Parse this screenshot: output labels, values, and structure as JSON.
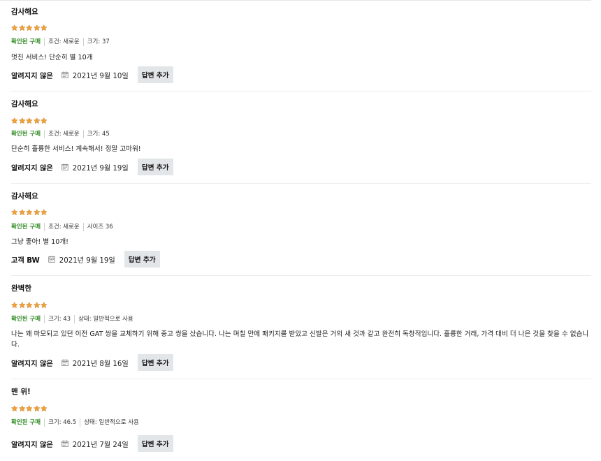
{
  "reviews": [
    {
      "title": "감사해요",
      "rating": 5,
      "verified_label": "확인된 구매",
      "attributes": [
        "조건: 새로운",
        "크기: 37"
      ],
      "body": "멋진 서비스! 단순히 별 10개",
      "author": "알려지지 않은",
      "date": "2021년 9월 10일",
      "reply_label": "답변 추가"
    },
    {
      "title": "감사해요",
      "rating": 5,
      "verified_label": "확인된 구매",
      "attributes": [
        "조건: 새로운",
        "크기: 45"
      ],
      "body": "단순히 훌륭한 서비스! 계속해서! 정말 고마워!",
      "author": "알려지지 않은",
      "date": "2021년 9월 19일",
      "reply_label": "답변 추가"
    },
    {
      "title": "감사해요",
      "rating": 5,
      "verified_label": "확인된 구매",
      "attributes": [
        "조건: 새로운",
        "사이즈 36"
      ],
      "body": "그냥 좋아! 별 10개!",
      "author": "고객 BW",
      "date": "2021년 9월 19일",
      "reply_label": "답변 추가"
    },
    {
      "title": "완벽한",
      "rating": 5,
      "verified_label": "확인된 구매",
      "attributes": [
        "크기: 43",
        "상태: 일반적으로 사용"
      ],
      "body": "나는 꽤 마모되고 있던 이전 GAT 쌍을 교체하기 위해 중고 쌍을 샀습니다. 나는 며칠 만에 패키지를 받았고 신발은 거의 새 것과 같고 완전히 독창적입니다. 훌륭한 거래, 가격 대비 더 나은 것을 찾을 수 없습니다.",
      "author": "알려지지 않은",
      "date": "2021년 8월 16일",
      "reply_label": "답변 추가"
    },
    {
      "title": "맨 위!",
      "rating": 5,
      "verified_label": "확인된 구매",
      "attributes": [
        "크기: 46.5",
        "상태: 일반적으로 사용"
      ],
      "body": "",
      "author": "알려지지 않은",
      "date": "2021년 7월 24일",
      "reply_label": "답변 추가"
    }
  ],
  "colors": {
    "star": "#f0a23a",
    "verified": "#2f8a22",
    "button_bg": "#e3e6e8",
    "divider": "#ececec"
  },
  "icons": {
    "star": "star-icon",
    "calendar": "calendar-icon"
  }
}
